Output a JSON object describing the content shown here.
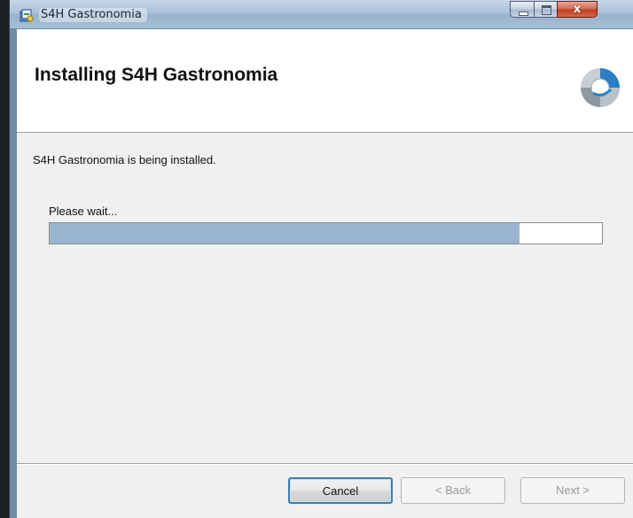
{
  "window": {
    "title": "S4H Gastronomia",
    "close_glyph": "x",
    "icons": [
      "installer-icon",
      "minimize-icon",
      "maximize-icon",
      "close-icon"
    ]
  },
  "banner": {
    "title": "Installing S4H Gastronomia",
    "logo_icon": "setup-disc-icon"
  },
  "body": {
    "status": "S4H Gastronomia is being installed.",
    "wait_label": "Please wait...",
    "progress_fraction": 0.85
  },
  "buttons": {
    "cancel": "Cancel",
    "back": "< Back",
    "next": "Next >"
  },
  "colors": {
    "progress_fill": "#9ab4d0",
    "close_button": "#c8452a",
    "focus_border": "#3c7fb1"
  }
}
